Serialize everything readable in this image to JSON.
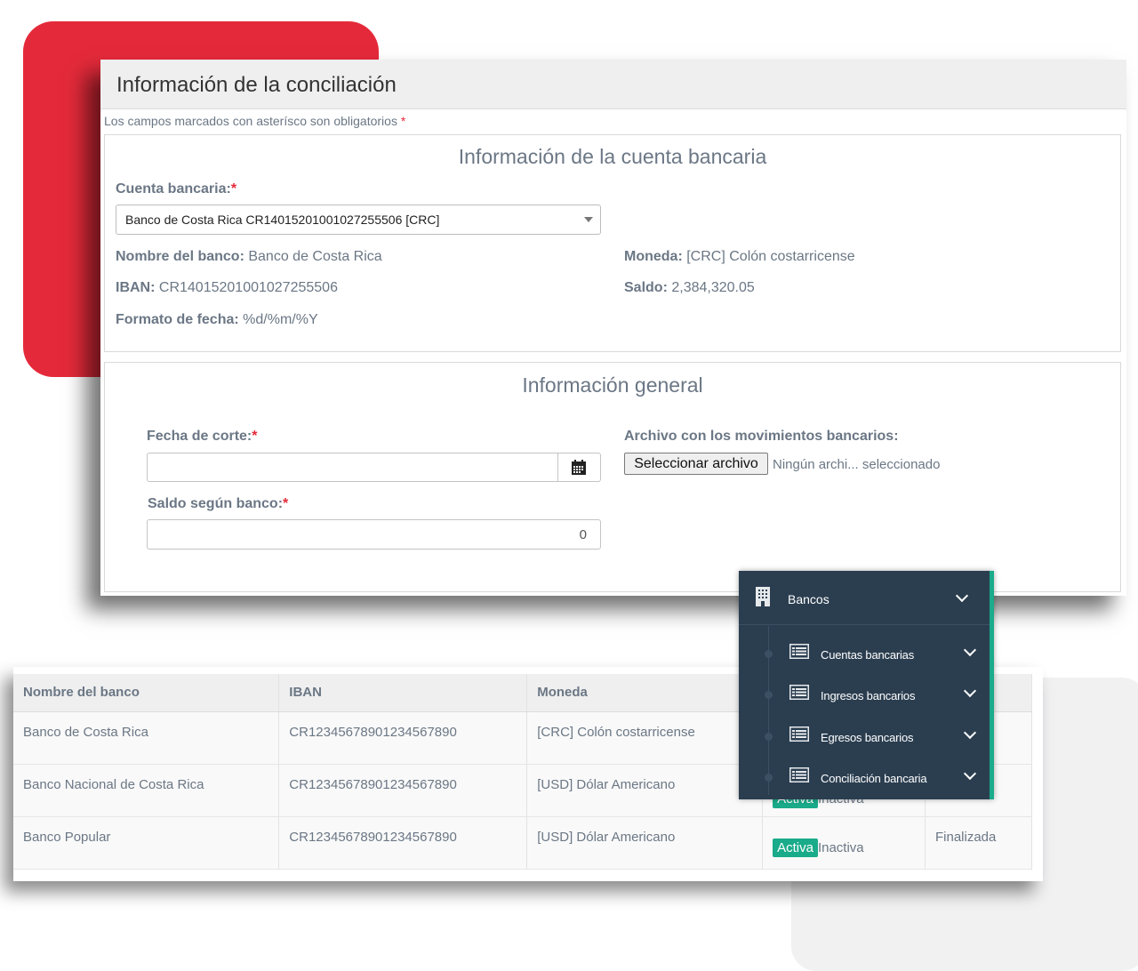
{
  "form": {
    "title": "Información de la conciliación",
    "required_note": "Los campos marcados con asterísco son obligatorios",
    "asterisk": "*",
    "bank_section": {
      "title": "Información de la cuenta bancaria",
      "account_label": "Cuenta bancaria:",
      "account_value": "Banco de Costa Rica CR14015201001027255506 [CRC]",
      "bank_name_label": "Nombre del banco:",
      "bank_name_value": "Banco de Costa Rica",
      "iban_label": "IBAN:",
      "iban_value": "CR14015201001027255506",
      "date_format_label": "Formato de fecha:",
      "date_format_value": "%d/%m/%Y",
      "currency_label": "Moneda:",
      "currency_value": "[CRC] Colón costarricense",
      "balance_label": "Saldo:",
      "balance_value": "2,384,320.05"
    },
    "general_section": {
      "title": "Información general",
      "cut_date_label": "Fecha de corte:",
      "cut_date_value": "",
      "bank_balance_label": "Saldo según banco:",
      "bank_balance_value": "0",
      "file_label": "Archivo con los movimientos bancarios:",
      "file_button": "Seleccionar archivo",
      "file_status": "Ningún archi... seleccionado"
    }
  },
  "table": {
    "headers": [
      "Nombre del banco",
      "IBAN",
      "Moneda",
      "",
      ""
    ],
    "rows": [
      {
        "bank": "Banco de Costa Rica",
        "iban": "CR12345678901234567890",
        "currency": "[CRC] Colón costarricense",
        "status_active": "",
        "status_inactive": "",
        "last": ""
      },
      {
        "bank": "Banco Nacional de Costa Rica",
        "iban": "CR12345678901234567890",
        "currency": "[USD] Dólar Americano",
        "status_active": "Activa",
        "status_inactive": "Inactiva",
        "last": ""
      },
      {
        "bank": "Banco Popular",
        "iban": "CR12345678901234567890",
        "currency": "[USD] Dólar Americano",
        "status_active": "Activa",
        "status_inactive": "Inactiva",
        "last": "Finalizada"
      }
    ]
  },
  "menu": {
    "header": {
      "label": "Bancos",
      "icon": "building-icon"
    },
    "items": [
      {
        "label": "Cuentas bancarias",
        "icon": "list-icon"
      },
      {
        "label": "Ingresos bancarios",
        "icon": "list-icon"
      },
      {
        "label": "Egresos bancarios",
        "icon": "list-icon"
      },
      {
        "label": "Conciliación bancaria",
        "icon": "list-icon"
      }
    ]
  },
  "colors": {
    "accent_red": "#e42a3a",
    "accent_green": "#1aab8a",
    "menu_bg": "#2b3e50"
  }
}
